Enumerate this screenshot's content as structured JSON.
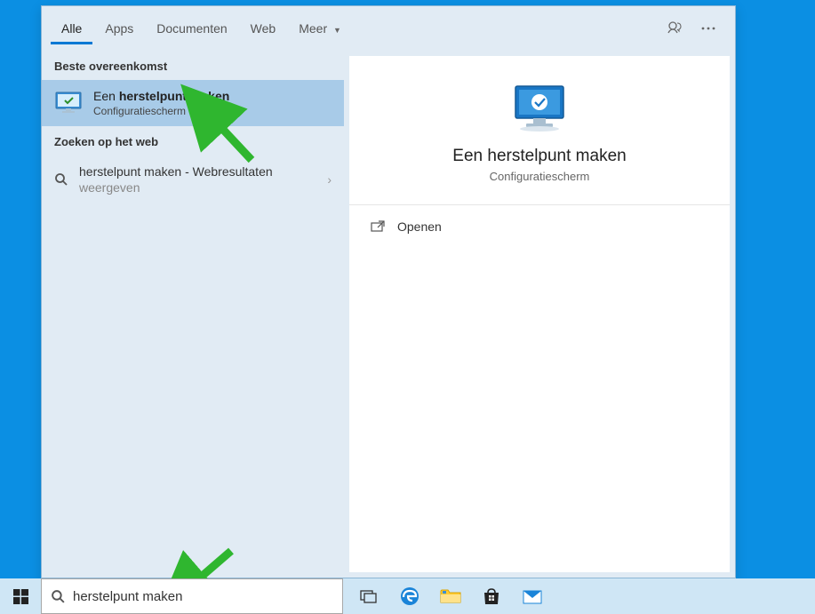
{
  "topbar": {
    "tabs": [
      {
        "label": "Alle",
        "active": true
      },
      {
        "label": "Apps",
        "active": false
      },
      {
        "label": "Documenten",
        "active": false
      },
      {
        "label": "Web",
        "active": false
      },
      {
        "label": "Meer",
        "active": false,
        "caret": true
      }
    ]
  },
  "sections": {
    "best_match": "Beste overeenkomst",
    "web_search": "Zoeken op het web"
  },
  "best_match_item": {
    "prefix": "Een ",
    "bold": "herstelpunt maken",
    "subtitle": "Configuratiescherm"
  },
  "web_result": {
    "query": "herstelpunt maken",
    "suffix": " - Webresultaten",
    "sub": "weergeven"
  },
  "detail": {
    "title": "Een herstelpunt maken",
    "subtitle": "Configuratiescherm"
  },
  "actions": {
    "open": "Openen"
  },
  "search": {
    "value": "herstelpunt maken"
  },
  "colors": {
    "accent": "#0078d4",
    "desktop": "#0b8fe3",
    "arrow": "#2fb62f"
  }
}
